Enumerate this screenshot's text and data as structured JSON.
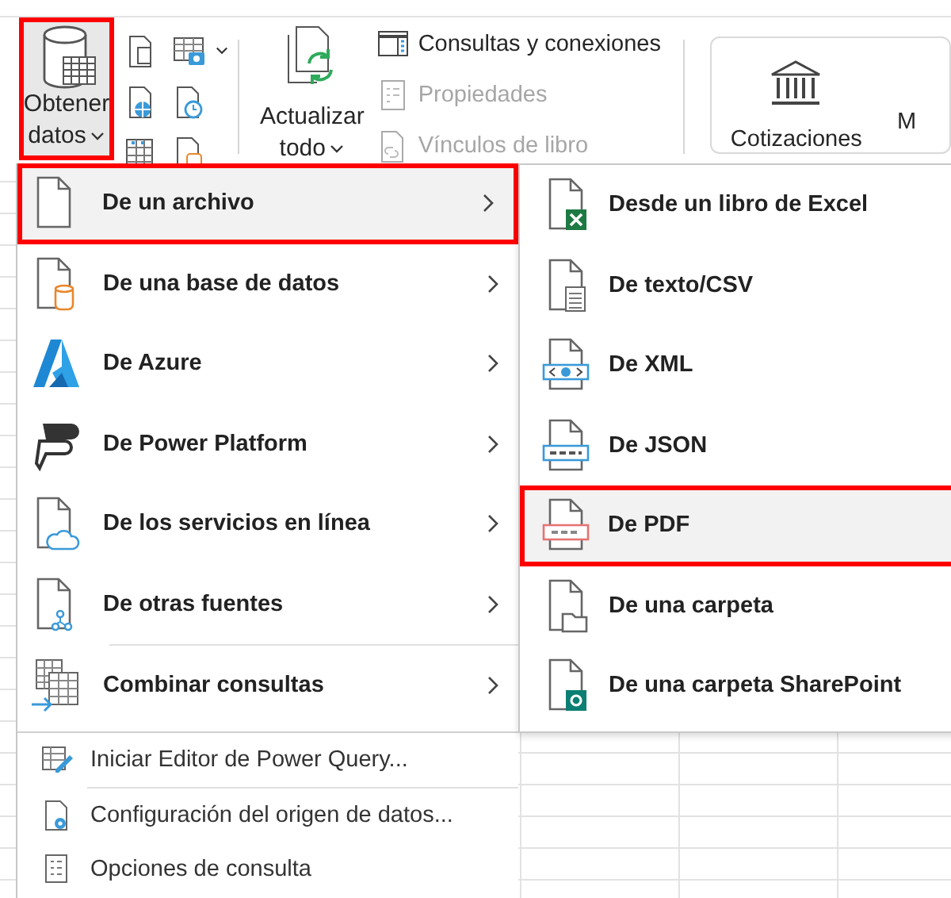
{
  "ribbon": {
    "get_data": {
      "label_1": "Obtener",
      "label_2": "datos",
      "highlighted": true
    },
    "refresh": {
      "label_1": "Actualizar",
      "label_2": "todo"
    },
    "query_items": [
      {
        "label": "Consultas y conexiones",
        "disabled": false
      },
      {
        "label": "Propiedades",
        "disabled": true
      },
      {
        "label": "Vínculos de libro",
        "disabled": true
      }
    ],
    "stocks": {
      "label": "Cotizaciones"
    },
    "cut_label": "M"
  },
  "menu": {
    "items": [
      {
        "label": "De un archivo",
        "selected": true,
        "highlighted": true
      },
      {
        "label": "De una base de datos",
        "selected": false,
        "highlighted": false
      },
      {
        "label": "De Azure",
        "selected": false,
        "highlighted": false
      },
      {
        "label": "De Power Platform",
        "selected": false,
        "highlighted": false
      },
      {
        "label": "De los servicios en línea",
        "selected": false,
        "highlighted": false
      },
      {
        "label": "De otras fuentes",
        "selected": false,
        "highlighted": false
      },
      {
        "label": "Combinar consultas",
        "selected": false,
        "highlighted": false
      }
    ],
    "commands": [
      {
        "label": "Iniciar Editor de Power Query..."
      },
      {
        "label": "Configuración del origen de datos..."
      },
      {
        "label": "Opciones de consulta"
      }
    ]
  },
  "submenu": {
    "items": [
      {
        "label": "Desde un libro de Excel",
        "selected": false,
        "highlighted": false
      },
      {
        "label": "De texto/CSV",
        "selected": false,
        "highlighted": false
      },
      {
        "label": "De XML",
        "selected": false,
        "highlighted": false
      },
      {
        "label": "De JSON",
        "selected": false,
        "highlighted": false
      },
      {
        "label": "De PDF",
        "selected": true,
        "highlighted": true
      },
      {
        "label": "De una carpeta",
        "selected": false,
        "highlighted": false
      },
      {
        "label": "De una carpeta SharePoint",
        "selected": false,
        "highlighted": false
      }
    ]
  }
}
